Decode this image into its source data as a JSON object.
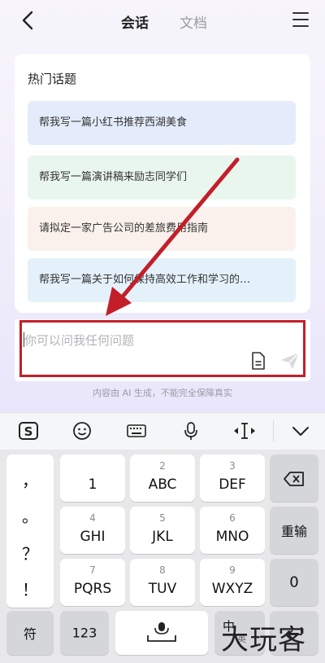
{
  "header": {
    "tab_chat": "会话",
    "tab_doc": "文档"
  },
  "hot_topics": {
    "title": "热门话题",
    "items": [
      "帮我写一篇小红书推荐西湖美食",
      "帮我写一篇演讲稿来励志同学们",
      "请拟定一家广告公司的差旅费用指南",
      "帮我写一篇关于如何保持高效工作和学习的…"
    ]
  },
  "input": {
    "placeholder": "你可以问我任何问题"
  },
  "disclaimer": "内容由 AI 生成，不能完全保障真实",
  "keyboard": {
    "punctuation": [
      "，",
      "。",
      "？",
      "！"
    ],
    "row1": [
      {
        "num": "",
        "label": "1"
      },
      {
        "num": "2",
        "label": "ABC"
      },
      {
        "num": "3",
        "label": "DEF"
      }
    ],
    "row2": [
      {
        "num": "4",
        "label": "GHI"
      },
      {
        "num": "5",
        "label": "JKL"
      },
      {
        "num": "6",
        "label": "MNO"
      }
    ],
    "row3": [
      {
        "num": "7",
        "label": "PQRS"
      },
      {
        "num": "8",
        "label": "TUV"
      },
      {
        "num": "9",
        "label": "WXYZ"
      }
    ],
    "reenter_label": "重输",
    "zero_label": "0",
    "symbol_label": "符",
    "numbers_label": "123",
    "lang_label": "中",
    "lang_sub": "英"
  },
  "watermark": "大玩客",
  "colors": {
    "highlight_red": "#c21f2a",
    "topic_blue": "#e4ecfb",
    "topic_green": "#e9f6ee",
    "topic_peach": "#fbf1ec"
  }
}
